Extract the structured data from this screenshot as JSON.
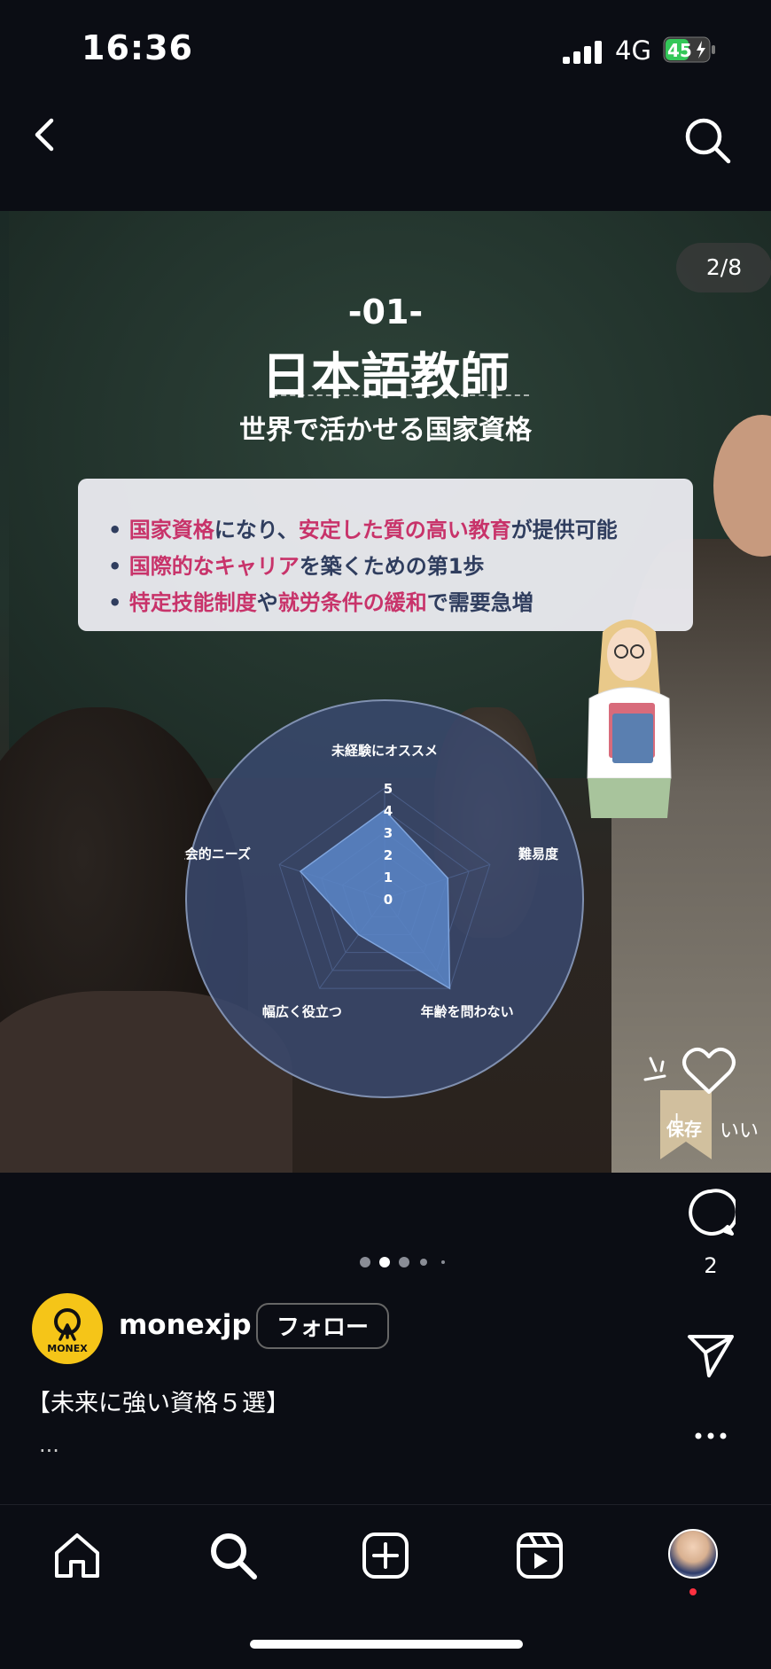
{
  "status_bar": {
    "time": "16:36",
    "network": "4G",
    "battery": "45"
  },
  "post": {
    "counter": "2/8",
    "slide": {
      "number": "-01-",
      "title": "日本語教師",
      "subtitle": "世界で活かせる国家資格",
      "bullets": [
        [
          {
            "t": "国家資格",
            "hl": true
          },
          {
            "t": "になり、",
            "hl": false
          },
          {
            "t": "安定した質の高い教育",
            "hl": true
          },
          {
            "t": "が提供可能",
            "hl": false
          }
        ],
        [
          {
            "t": "国際的なキャリア",
            "hl": true
          },
          {
            "t": "を築くための第1歩",
            "hl": false
          }
        ],
        [
          {
            "t": "特定技能制度",
            "hl": true
          },
          {
            "t": "や",
            "hl": false
          },
          {
            "t": "就労条件の緩和",
            "hl": true
          },
          {
            "t": "で需要急増",
            "hl": false
          }
        ]
      ],
      "save_badge": {
        "text": "保存",
        "extra": "!",
        "partial": "いい"
      }
    },
    "comment_count": "2",
    "carousel": {
      "total": 5,
      "active": 1
    }
  },
  "chart_data": {
    "type": "radar",
    "axes": [
      "未経験にオススメ",
      "難易度",
      "年齢を問わない",
      "幅広く役立つ",
      "社会的ニーズ"
    ],
    "scale_labels": [
      "5",
      "4",
      "3",
      "2",
      "1",
      "0"
    ],
    "rmax": 5,
    "values": [
      4,
      3,
      5,
      2,
      4
    ],
    "colors": {
      "fill": "#5b86c8",
      "background": "#3a4b72"
    }
  },
  "author": {
    "username": "monexjp",
    "follow_label": "フォロー",
    "logo_text": "MONEX"
  },
  "caption": {
    "text": "【未来に強い資格５選】",
    "more": "..."
  },
  "colors": {
    "highlight": "#c8336a",
    "bullet_text": "#2f3d5e",
    "background": "#0b0d14"
  },
  "icons": [
    "back-icon",
    "search-icon",
    "heart-icon",
    "comment-icon",
    "share-icon",
    "more-icon",
    "home-icon",
    "add-icon",
    "reels-icon"
  ]
}
